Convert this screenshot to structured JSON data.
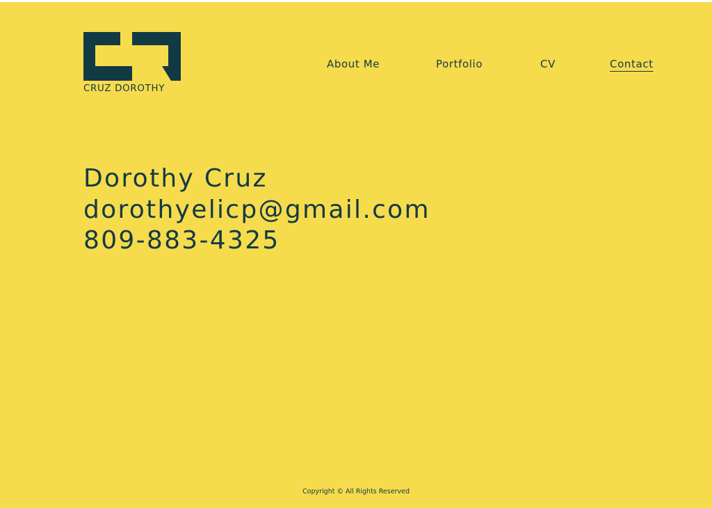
{
  "brand": {
    "name": "CRUZ DOROTHY",
    "logo_icon": "cd-monogram-logo"
  },
  "nav": {
    "items": [
      {
        "label": "About Me",
        "active": false
      },
      {
        "label": "Portfolio",
        "active": false
      },
      {
        "label": "CV",
        "active": false
      },
      {
        "label": "Contact",
        "active": true
      }
    ]
  },
  "contact": {
    "name": "Dorothy Cruz",
    "email": "dorothyelicp@gmail.com",
    "phone": "809-883-4325"
  },
  "footer": {
    "copyright": "Copyright © All Rights Reserved"
  },
  "colors": {
    "background": "#f6db4c",
    "text": "#123a45"
  }
}
